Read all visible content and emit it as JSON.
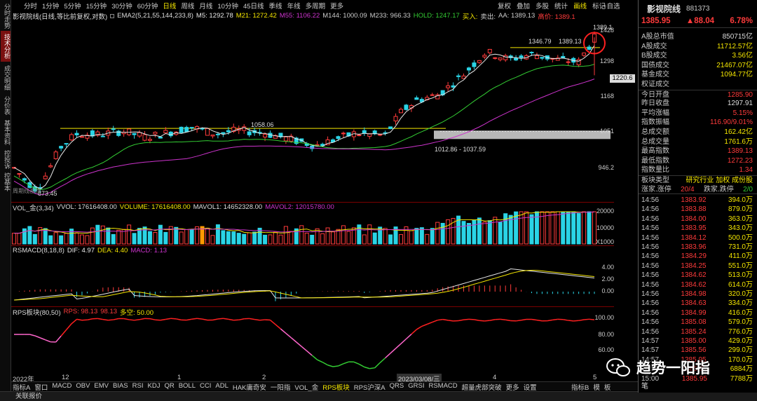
{
  "left_tabs": [
    "分时走势",
    "技术分析",
    "成交明细",
    "分价表",
    "基本资料",
    "控投诉",
    "控基本"
  ],
  "periods": [
    "分时",
    "1分钟",
    "5分钟",
    "15分钟",
    "30分钟",
    "60分钟",
    "日线",
    "周线",
    "月线",
    "10分钟",
    "45日线",
    "季线",
    "年线",
    "多周期",
    "更多"
  ],
  "period_selected": "日线",
  "tools": [
    "复权",
    "叠加",
    "多股",
    "统计",
    "画线",
    "标记"
  ],
  "tool_selected": "画线",
  "self_select": "+自选",
  "main_info": {
    "title": "影视院线(日线,等比前复权,对数)",
    "ema": "EMA2(5,21,55,144,233,8)",
    "m5": "M5: 1292.78",
    "m21": "M21: 1272.42",
    "m55": "M55: 1106.22",
    "m144": "M144: 1000.09",
    "m233": "M233: 966.33",
    "hold": "HOLD: 1247.17",
    "buy": "买入:",
    "sell": "卖出:",
    "aa": "AA: 1389.13",
    "high_label": "高价: 1389.1"
  },
  "y_axis_main": [
    "1428",
    "1298",
    "1168",
    "1051",
    "946.2"
  ],
  "price_tag": "1220.6",
  "annotations": {
    "h1": "1346.79",
    "h2": "1389.13",
    "h3": "1389.1",
    "mid": "1058.06",
    "low": "873.45",
    "range": "1012.86 - 1037.59",
    "corner": "周期线画线"
  },
  "vol_info": {
    "name": "VOL_金(3,34)",
    "vvol": "VVOL: 17616408.00",
    "volume": "VOLUME: 17616408.00",
    "mavol1": "MAVOL1: 14652328.00",
    "mavol2": "MAVOL2: 12015780.00"
  },
  "y_axis_vol": [
    "20000",
    "10000",
    "X1000"
  ],
  "macd_info": {
    "name": "RSMACD(8,18,8)",
    "dif": "DIF: 4.97",
    "dea": "DEA: 4.40",
    "macd": "MACD: 1.13"
  },
  "y_axis_macd": [
    "4.00",
    "2.00",
    "0.00"
  ],
  "rps_info": {
    "name": "RPS板块(80,50)",
    "rps": "RPS: 98.13",
    "rps2": "98.13",
    "dk": "多空: 50.00"
  },
  "y_axis_rps": [
    "100.00",
    "80.00",
    "60.00"
  ],
  "x_axis": [
    "2022年",
    "12",
    "1",
    "2",
    "2023/03/08/三",
    "4",
    "5"
  ],
  "bottom_tabs": [
    "指标A",
    "窗口",
    "MACD",
    "OBV",
    "EMV",
    "BIAS",
    "RSI",
    "KDJ",
    "QR",
    "BOLL",
    "CCI",
    "ADL",
    "HAK庸奇安",
    "一阳指",
    "VOL_金",
    "RPS板块",
    "RPS沪深A",
    "QRS",
    "GRSI",
    "RSMACD",
    "超量虎部突破",
    "更多",
    "设置"
  ],
  "bottom_tab_selected": "RPS板块",
  "bottom_right": [
    "指标B",
    "模",
    "板"
  ],
  "status": "关联报价",
  "right_panel": {
    "name": "影视院线",
    "code": "881373",
    "price": "1385.95",
    "change": "▲88.04",
    "pct": "6.78%",
    "stats": [
      [
        "A股总市值",
        "850715亿"
      ],
      [
        "A股成交",
        "11712.57亿"
      ],
      [
        "B股成交",
        "3.56亿"
      ],
      [
        "国债成交",
        "21467.07亿"
      ],
      [
        "基金成交",
        "1094.77亿"
      ],
      [
        "权证成交",
        ""
      ],
      [
        "今日开盘",
        "1285.90"
      ],
      [
        "昨日收盘",
        "1297.91"
      ],
      [
        "平均涨幅",
        "5.15%"
      ],
      [
        "指数振幅",
        "116.90/9.01%"
      ],
      [
        "总成交额",
        "162.42亿"
      ],
      [
        "总成交量",
        "1761.6万"
      ],
      [
        "最高指数",
        "1389.13"
      ],
      [
        "最低指数",
        "1272.23"
      ],
      [
        "指数量比",
        "1.34"
      ]
    ],
    "sector": [
      "板块类型",
      "研究行业 加权 成份股"
    ],
    "updown": [
      "涨家.涨停",
      "20/4",
      "跌家.跌停",
      "2/0"
    ],
    "ticks": [
      [
        "14:56",
        "1383.92",
        "394.0万"
      ],
      [
        "14:56",
        "1383.88",
        "879.0万"
      ],
      [
        "14:56",
        "1384.00",
        "363.0万"
      ],
      [
        "14:56",
        "1383.95",
        "343.0万"
      ],
      [
        "14:56",
        "1384.12",
        "500.0万"
      ],
      [
        "14:56",
        "1383.96",
        "731.0万"
      ],
      [
        "14:56",
        "1384.29",
        "411.0万"
      ],
      [
        "14:56",
        "1384.25",
        "551.0万"
      ],
      [
        "14:56",
        "1384.62",
        "513.0万"
      ],
      [
        "14:56",
        "1384.62",
        "614.0万"
      ],
      [
        "14:56",
        "1384.98",
        "320.0万"
      ],
      [
        "14:56",
        "1384.63",
        "334.0万"
      ],
      [
        "14:56",
        "1384.99",
        "416.0万"
      ],
      [
        "14:56",
        "1385.08",
        "579.0万"
      ],
      [
        "14:56",
        "1385.24",
        "776.0万"
      ],
      [
        "14:57",
        "1385.00",
        "429.0万"
      ],
      [
        "14:57",
        "1385.56",
        "299.0万"
      ],
      [
        "14:57",
        "1385.95",
        "170.0万"
      ],
      [
        "14:57",
        "1385.95",
        "6884万"
      ],
      [
        "15:00",
        "1385.95",
        "7788万"
      ]
    ],
    "footer": [
      "笔"
    ]
  },
  "watermark": "趋势一阳指",
  "colors": {
    "up": "#ff3b3b",
    "down": "#2ad4e6",
    "yellow": "#f4e600",
    "magenta": "#cc33cc",
    "green": "#33cc33",
    "white": "#e8e8e8"
  },
  "chart_data": {
    "type": "candlestick",
    "series": "影视院线 daily",
    "ylim": [
      873.45,
      1428
    ],
    "hlines": [
      1058.06,
      1346.79
    ]
  }
}
